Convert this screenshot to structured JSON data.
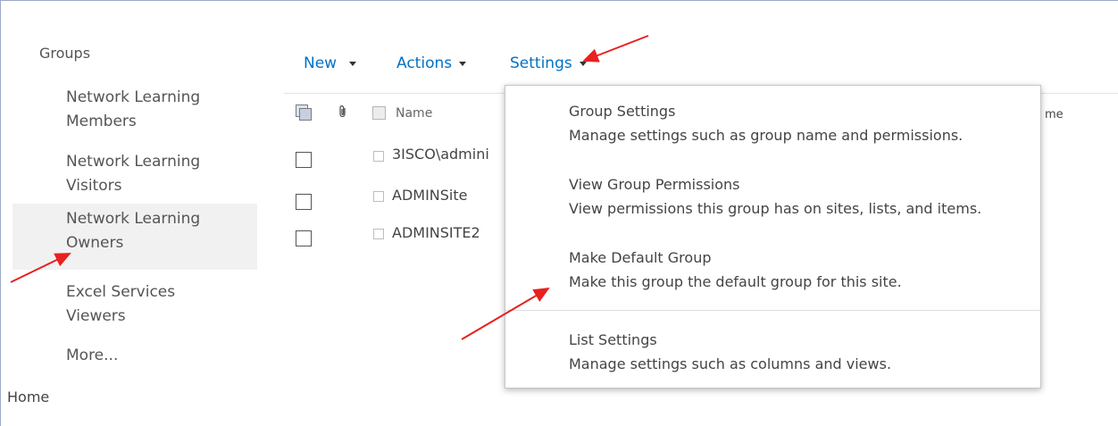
{
  "nav": {
    "heading": "Groups",
    "items": [
      {
        "line1": "Network Learning",
        "line2": "Members",
        "selected": false
      },
      {
        "line1": "Network Learning",
        "line2": "Visitors",
        "selected": false
      },
      {
        "line1": "Network Learning",
        "line2": "Owners",
        "selected": true
      },
      {
        "line1": "Excel Services",
        "line2": "Viewers",
        "selected": false
      }
    ],
    "more": "More...",
    "home": "Home"
  },
  "toolbar": {
    "new_label": "New",
    "actions_label": "Actions",
    "settings_label": "Settings"
  },
  "list": {
    "name_header": "Name",
    "right_header_fragment": "me",
    "rows": [
      {
        "name": "3ISCO\\admini"
      },
      {
        "name": "ADMINSite"
      },
      {
        "name": "ADMINSITE2"
      }
    ]
  },
  "menu": {
    "items": [
      {
        "title": "Group Settings",
        "description": "Manage settings such as group name and permissions."
      },
      {
        "title": "View Group Permissions",
        "description": "View permissions this group has on sites, lists, and items."
      },
      {
        "title": "Make Default Group",
        "description": "Make this group the default group for this site."
      },
      {
        "title": "List Settings",
        "description": "Manage settings such as columns and views."
      }
    ]
  },
  "colors": {
    "link_blue": "#0072c6",
    "annotation_red": "#e8201f",
    "selected_bg": "#f1f1f1"
  }
}
